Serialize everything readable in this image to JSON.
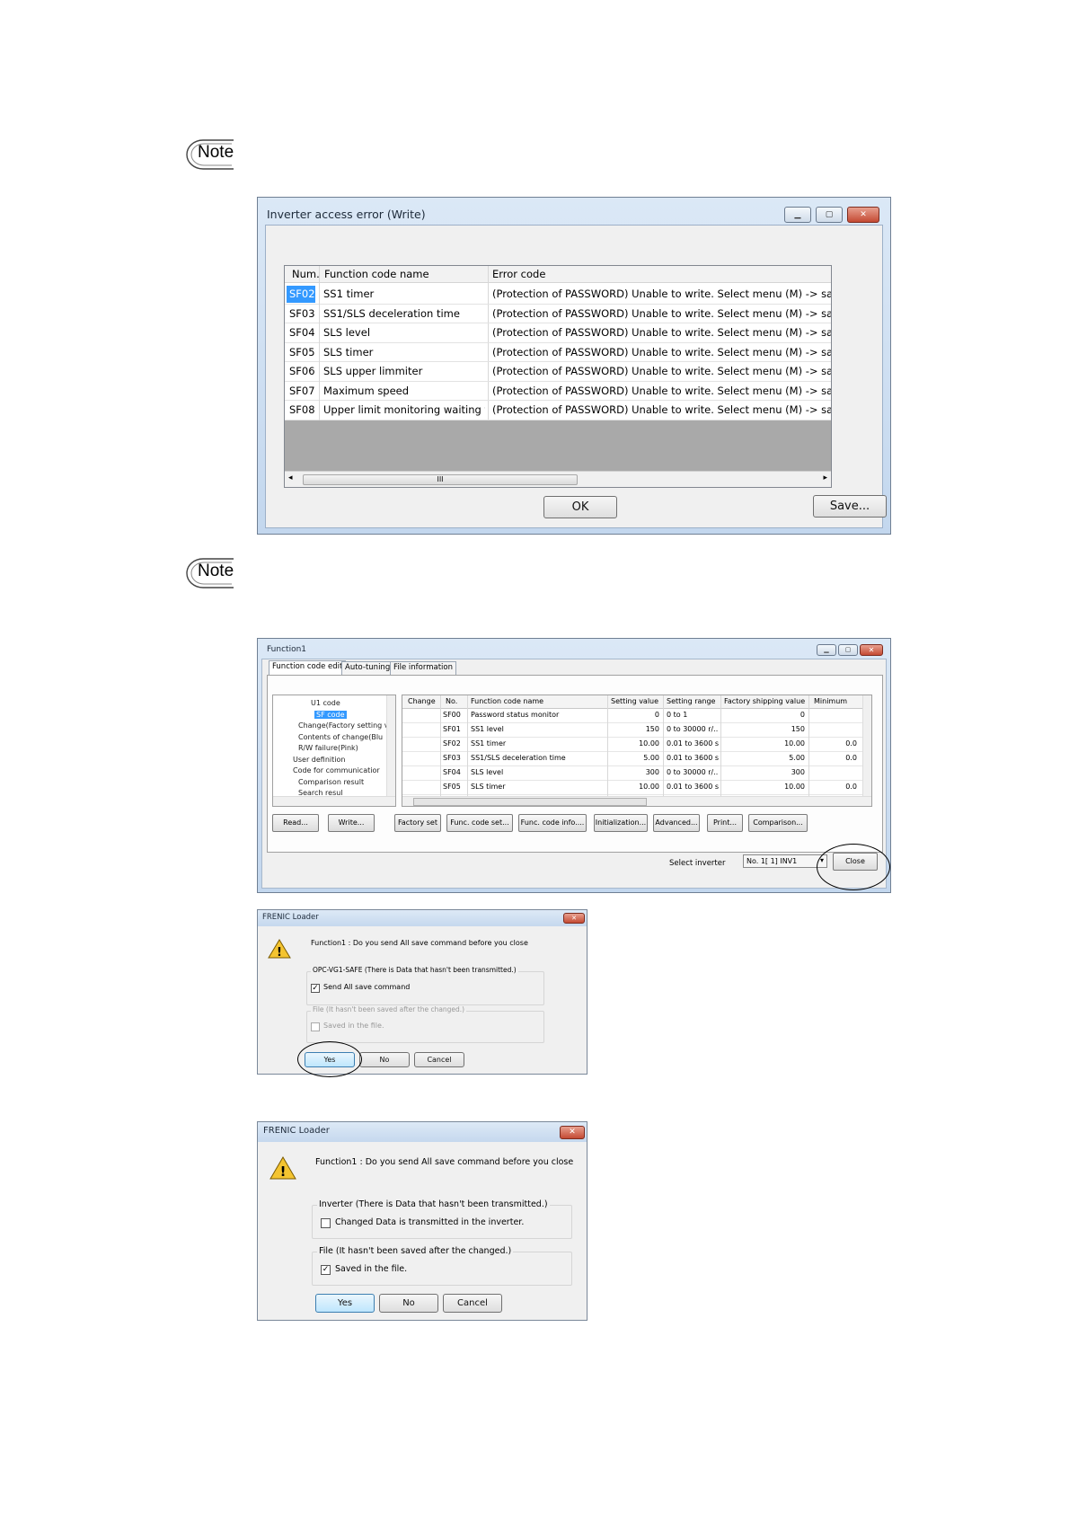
{
  "notes": [
    {
      "label": "Note"
    },
    {
      "label": "Note"
    }
  ],
  "error_window": {
    "title": "Inverter access error (Write)",
    "columns": {
      "num": "Num.",
      "name": "Function code name",
      "error": "Error code"
    },
    "rows": [
      {
        "num": "SF02",
        "name": "SS1 timer",
        "error": "(Protection of PASSWORD) Unable to write. Select menu (M) -> safe function, and",
        "selected": true
      },
      {
        "num": "SF03",
        "name": "SS1/SLS deceleration time",
        "error": "(Protection of PASSWORD) Unable to write. Select menu (M) -> safe function, and"
      },
      {
        "num": "SF04",
        "name": "SLS level",
        "error": "(Protection of PASSWORD) Unable to write. Select menu (M) -> safe function, and"
      },
      {
        "num": "SF05",
        "name": "SLS timer",
        "error": "(Protection of PASSWORD) Unable to write. Select menu (M) -> safe function, and"
      },
      {
        "num": "SF06",
        "name": "SLS upper limmiter",
        "error": "(Protection of PASSWORD) Unable to write. Select menu (M) -> safe function, and"
      },
      {
        "num": "SF07",
        "name": "Maximum speed",
        "error": "(Protection of PASSWORD) Unable to write. Select menu (M) -> safe function, and"
      },
      {
        "num": "SF08",
        "name": "Upper limit monitoring waiting time",
        "error": "(Protection of PASSWORD) Unable to write. Select menu (M) -> safe function, and"
      }
    ],
    "scroll_grip": "III",
    "ok_label": "OK",
    "save_label": "Save..."
  },
  "function_window": {
    "title": "Function1",
    "tabs": [
      "Function code edit",
      "Auto-tuning",
      "File information"
    ],
    "tree": [
      "U1 code",
      "SF code",
      "Change(Factory setting v",
      "Contents of change(Blu",
      "R/W failure(Pink)",
      "User definition",
      "Code for communicatior",
      "Comparison result",
      "Search resul"
    ],
    "tree_selected": "SF code",
    "grid_columns": [
      "Change",
      "No.",
      "Function code name",
      "Setting value",
      "Setting range",
      "Factory shipping value",
      "Minimum"
    ],
    "grid_rows": [
      {
        "no": "SF00",
        "name": "Password status monitor",
        "value": "0",
        "range": "0 to 1",
        "factory": "0",
        "min": ""
      },
      {
        "no": "SF01",
        "name": "SS1 level",
        "value": "150",
        "range": "0 to 30000 r/...",
        "factory": "150",
        "min": ""
      },
      {
        "no": "SF02",
        "name": "SS1 timer",
        "value": "10.00",
        "range": "0.01 to 3600 s",
        "factory": "10.00",
        "min": "0.0"
      },
      {
        "no": "SF03",
        "name": "SS1/SLS deceleration time",
        "value": "5.00",
        "range": "0.01 to 3600 s",
        "factory": "5.00",
        "min": "0.0"
      },
      {
        "no": "SF04",
        "name": "SLS level",
        "value": "300",
        "range": "0 to 30000 r/...",
        "factory": "300",
        "min": ""
      },
      {
        "no": "SF05",
        "name": "SLS timer",
        "value": "10.00",
        "range": "0.01 to 3600 s",
        "factory": "10.00",
        "min": "0.0"
      }
    ],
    "buttons": [
      "Read...",
      "Write...",
      "Factory set",
      "Func. code set...",
      "Func. code info....",
      "Initialization...",
      "Advanced...",
      "Print...",
      "Comparison..."
    ],
    "select_inverter_label": "Select inverter",
    "select_inverter_value": "No. 1[  1] INV1",
    "close_label": "Close"
  },
  "dialog1": {
    "title": "FRENIC Loader",
    "message": "Function1 : Do you send All save command before you close",
    "group1_label": "OPC-VG1-SAFE (There is Data that hasn't been transmitted.)",
    "group1_check": "Send All save command",
    "group1_checked": true,
    "group2_label": "File (It hasn't been saved after the changed.)",
    "group2_check": "Saved in the file.",
    "group2_checked": false,
    "yes": "Yes",
    "no": "No",
    "cancel": "Cancel"
  },
  "dialog2": {
    "title": "FRENIC Loader",
    "message": "Function1 : Do you send All save command before you close",
    "group1_label": "Inverter (There is Data that hasn't been transmitted.)",
    "group1_check": "Changed Data is transmitted in the inverter.",
    "group1_checked": false,
    "group2_label": "File (It hasn't been saved after the changed.)",
    "group2_check": "Saved in the file.",
    "group2_checked": true,
    "yes": "Yes",
    "no": "No",
    "cancel": "Cancel"
  }
}
